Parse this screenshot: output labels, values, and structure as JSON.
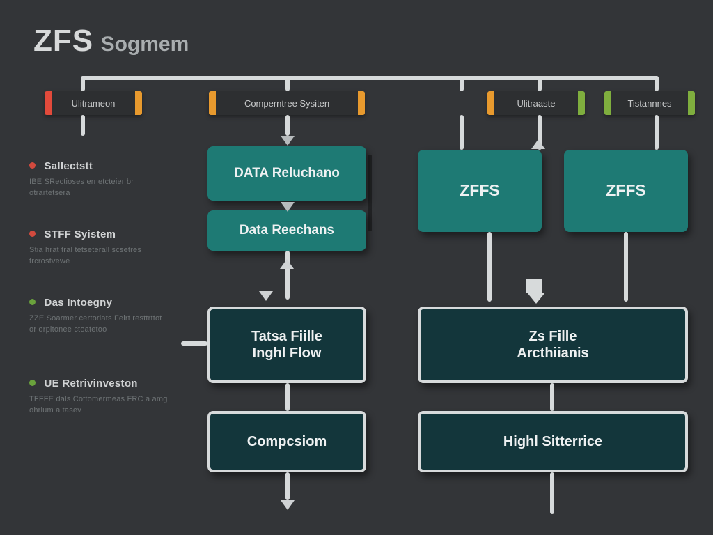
{
  "title": {
    "strong": "ZFS",
    "sub": "Sogmem"
  },
  "tabs": [
    {
      "label": "Ulitrameon",
      "cap_left": "#e24a3b",
      "cap_right": "#e89a2e"
    },
    {
      "label": "Comperntree Sysiten",
      "cap_left": "#e89a2e",
      "cap_right": "#e89a2e"
    },
    {
      "label": "Ulitraaste",
      "cap_left": "#e89a2e",
      "cap_right": "#7fae3e"
    },
    {
      "label": "Tistannnes",
      "cap_left": "#7fae3e",
      "cap_right": "#7fae3e"
    }
  ],
  "boxes": {
    "b1": "DATA Reluchano",
    "b2": "Data Reechans",
    "b3": "ZFFS",
    "b4": "ZFFS",
    "b5": "Tatsa Fiille\nInghl Flow",
    "b6": "Zs Fille\nArcthiianis",
    "b7": "Compcsiom",
    "b8": "Highl Sitterrice"
  },
  "legend": [
    {
      "color": "#d24a3e",
      "title": "Sallectstt",
      "desc": "IBE SRectioses ernetcteier br otrartetsera"
    },
    {
      "color": "#d24a3e",
      "title": "STFF Syistem",
      "desc": "Stia hrat tral tetseterall scsetres trcrostvewe"
    },
    {
      "color": "#6aa23c",
      "title": "Das Intoegny",
      "desc": "ZZE Soarmer certorlats Feirt resttrttot or orpitonee ctoatetoo"
    },
    {
      "color": "#6aa23c",
      "title": "UE Retrivinveston",
      "desc": "TFFFE dals Cottomermeas FRC a amg ohrium a tasev"
    }
  ],
  "colors": {
    "bg": "#333538",
    "teal": "#1e7a74",
    "dark_teal": "#13363b",
    "connector": "#d7dadb"
  }
}
